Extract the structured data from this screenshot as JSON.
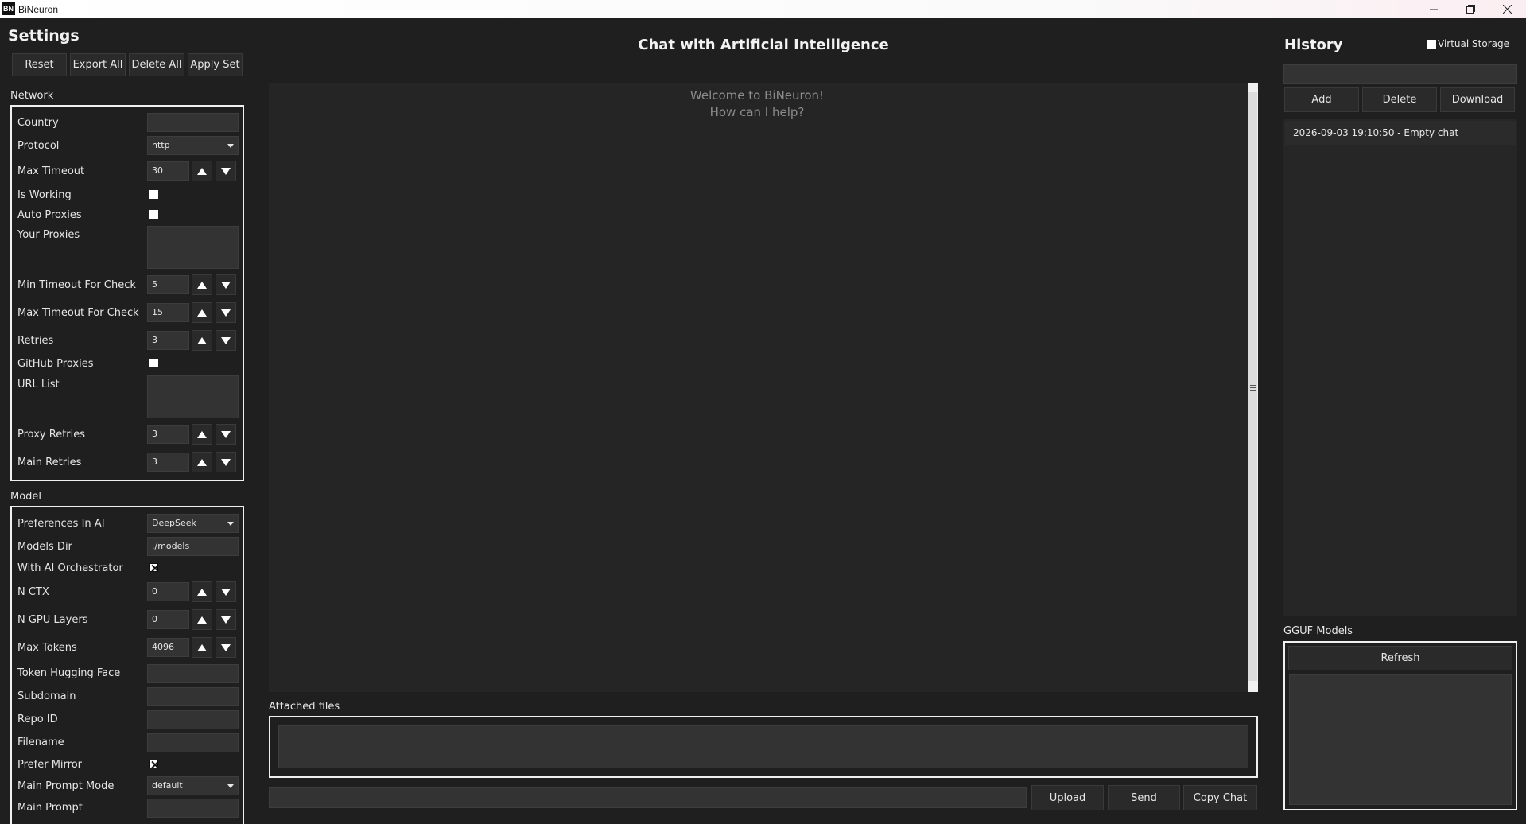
{
  "window": {
    "title": "BiNeuron",
    "icon_text": "BN"
  },
  "settings": {
    "title": "Settings",
    "buttons": [
      "Reset",
      "Export All",
      "Delete All",
      "Apply Set"
    ],
    "network": {
      "title": "Network",
      "country": {
        "label": "Country",
        "value": ""
      },
      "protocol": {
        "label": "Protocol",
        "value": "http"
      },
      "max_timeout": {
        "label": "Max Timeout",
        "value": "30"
      },
      "is_working": {
        "label": "Is Working",
        "checked": false
      },
      "auto_proxies": {
        "label": "Auto Proxies",
        "checked": false
      },
      "your_proxies": {
        "label": "Your Proxies",
        "value": ""
      },
      "min_timeout_check": {
        "label": "Min Timeout For Check",
        "value": "5"
      },
      "max_timeout_check": {
        "label": "Max Timeout For Check",
        "value": "15"
      },
      "retries": {
        "label": "Retries",
        "value": "3"
      },
      "github_proxies": {
        "label": "GitHub Proxies",
        "checked": false
      },
      "url_list": {
        "label": "URL List",
        "value": ""
      },
      "proxy_retries": {
        "label": "Proxy Retries",
        "value": "3"
      },
      "main_retries": {
        "label": "Main Retries",
        "value": "3"
      }
    },
    "model": {
      "title": "Model",
      "preferences_in_ai": {
        "label": "Preferences In AI",
        "value": "DeepSeek"
      },
      "models_dir": {
        "label": "Models Dir",
        "value": "./models"
      },
      "with_ai_orchestrator": {
        "label": "With AI Orchestrator",
        "checked": true
      },
      "n_ctx": {
        "label": "N CTX",
        "value": "0"
      },
      "n_gpu_layers": {
        "label": "N GPU Layers",
        "value": "0"
      },
      "max_tokens": {
        "label": "Max Tokens",
        "value": "4096"
      },
      "token_hugging_face": {
        "label": "Token Hugging Face",
        "value": ""
      },
      "subdomain": {
        "label": "Subdomain",
        "value": ""
      },
      "repo_id": {
        "label": "Repo ID",
        "value": ""
      },
      "filename": {
        "label": "Filename",
        "value": ""
      },
      "prefer_mirror": {
        "label": "Prefer Mirror",
        "checked": true
      },
      "main_prompt_mode": {
        "label": "Main Prompt Mode",
        "value": "default"
      },
      "main_prompt": {
        "label": "Main Prompt",
        "value": ""
      }
    }
  },
  "chat": {
    "title": "Chat with Artificial Intelligence",
    "welcome_line1": "Welcome to BiNeuron!",
    "welcome_line2": "How can I help?",
    "attached_files_label": "Attached files",
    "input_value": "",
    "upload_label": "Upload",
    "send_label": "Send",
    "copy_chat_label": "Copy Chat"
  },
  "history": {
    "title": "History",
    "virtual_storage_label": "Virtual Storage",
    "virtual_storage_checked": false,
    "search_value": "",
    "add_label": "Add",
    "delete_label": "Delete",
    "download_label": "Download",
    "items": [
      "2026-09-03 19:10:50 - Empty chat"
    ]
  },
  "gguf": {
    "title": "GGUF Models",
    "refresh_label": "Refresh"
  },
  "icons": {
    "minimize": "minimize-icon",
    "maximize": "restore-icon",
    "close": "close-icon",
    "spin_up": "triangle-up-icon",
    "spin_down": "triangle-down-icon",
    "dropdown": "chevron-down-icon"
  }
}
